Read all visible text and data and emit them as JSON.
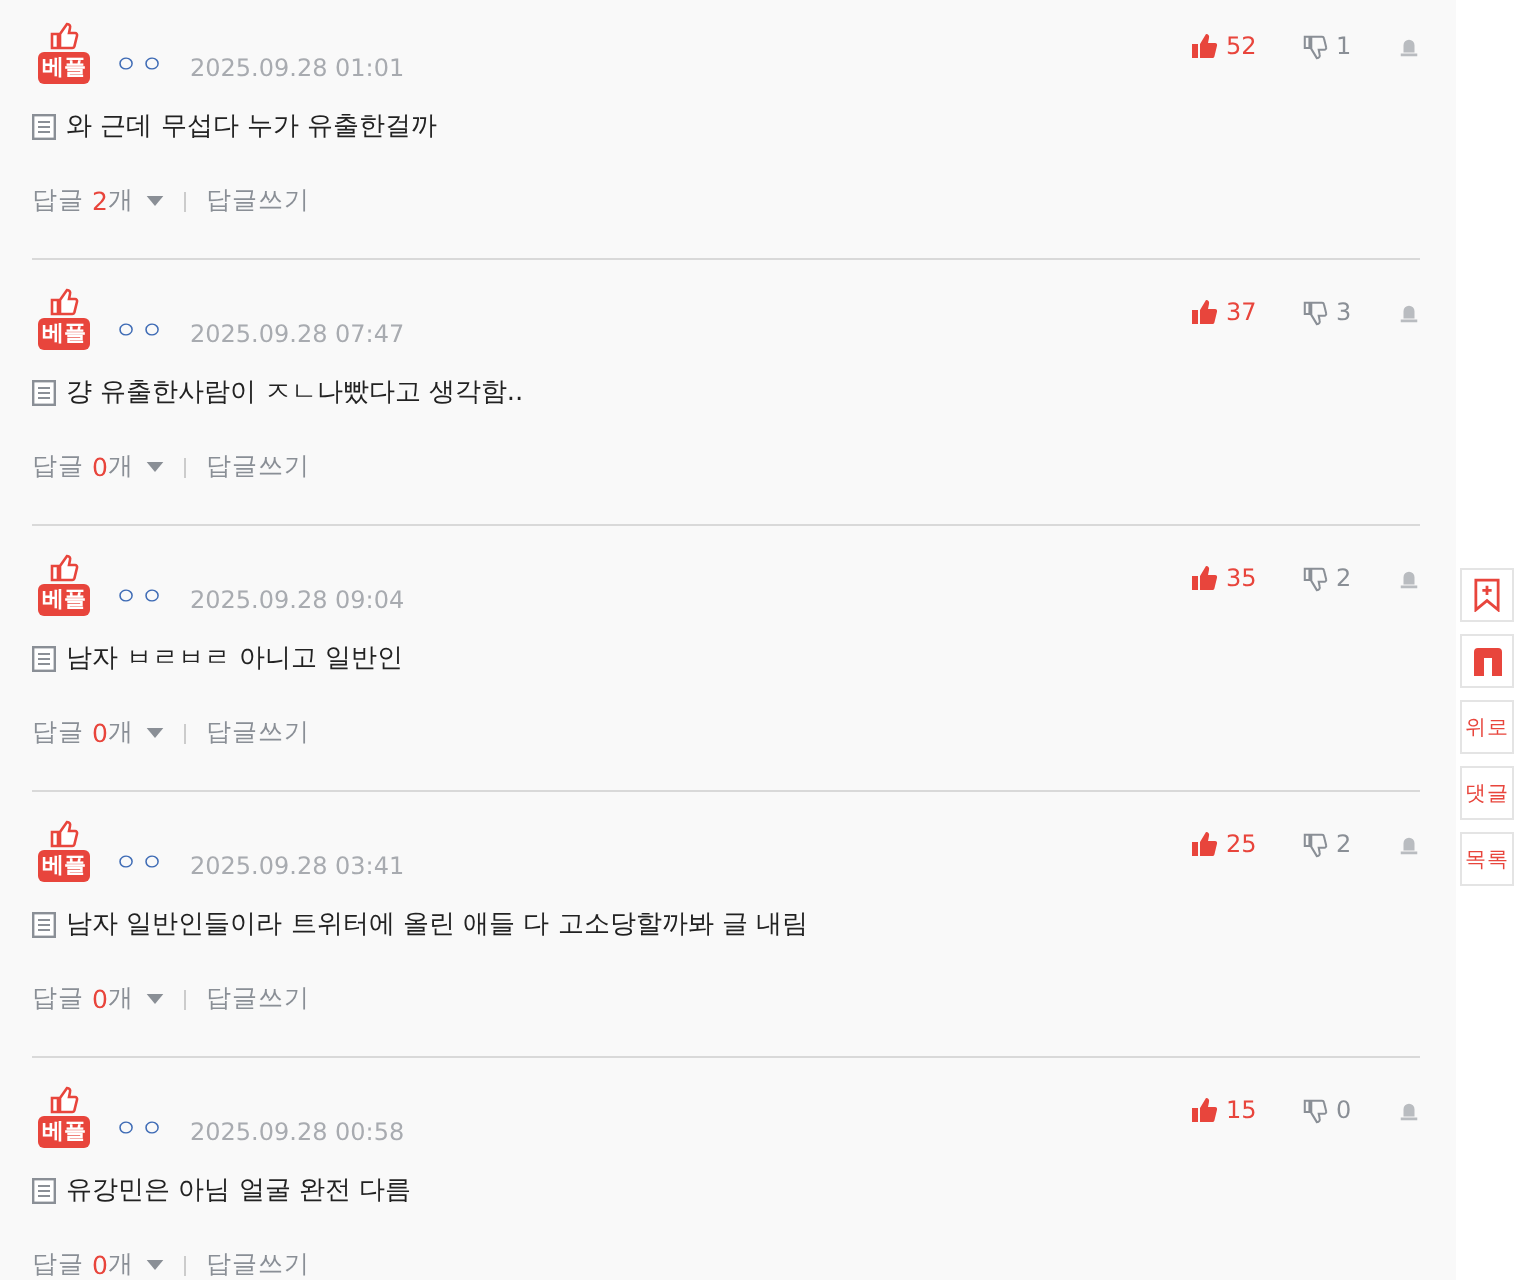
{
  "comments": [
    {
      "best": true,
      "badge": "베플",
      "nickname": "ㅇㅇ",
      "date": "2025.09.28 01:01",
      "likes": "52",
      "dislikes": "1",
      "text": "와 근데 무섭다 누가 유출한걸까",
      "reply_label": "답글",
      "reply_count": "2",
      "reply_unit": "개",
      "write_reply": "답글쓰기"
    },
    {
      "best": true,
      "badge": "베플",
      "nickname": "ㅇㅇ",
      "date": "2025.09.28 07:47",
      "likes": "37",
      "dislikes": "3",
      "text": "걍 유출한사람이 ㅈㄴ나빴다고 생각함..",
      "reply_label": "답글",
      "reply_count": "0",
      "reply_unit": "개",
      "write_reply": "답글쓰기"
    },
    {
      "best": true,
      "badge": "베플",
      "nickname": "ㅇㅇ",
      "date": "2025.09.28 09:04",
      "likes": "35",
      "dislikes": "2",
      "text": "남자 ㅂㄹㅂㄹ 아니고 일반인",
      "reply_label": "답글",
      "reply_count": "0",
      "reply_unit": "개",
      "write_reply": "답글쓰기"
    },
    {
      "best": true,
      "badge": "베플",
      "nickname": "ㅇㅇ",
      "date": "2025.09.28 03:41",
      "likes": "25",
      "dislikes": "2",
      "text": "남자 일반인들이라 트위터에 올린 애들 다 고소당할까봐 글 내림",
      "reply_label": "답글",
      "reply_count": "0",
      "reply_unit": "개",
      "write_reply": "답글쓰기"
    },
    {
      "best": true,
      "badge": "베플",
      "nickname": "ㅇㅇ",
      "date": "2025.09.28 00:58",
      "likes": "15",
      "dislikes": "0",
      "text": "유강민은 아님 얼굴 완전 다름",
      "reply_label": "답글",
      "reply_count": "0",
      "reply_unit": "개",
      "write_reply": "답글쓰기"
    }
  ],
  "side_buttons": [
    {
      "kind": "bookmark"
    },
    {
      "kind": "logo"
    },
    {
      "kind": "text",
      "label": "위로"
    },
    {
      "kind": "text",
      "label": "댓글"
    },
    {
      "kind": "text",
      "label": "목록"
    }
  ]
}
